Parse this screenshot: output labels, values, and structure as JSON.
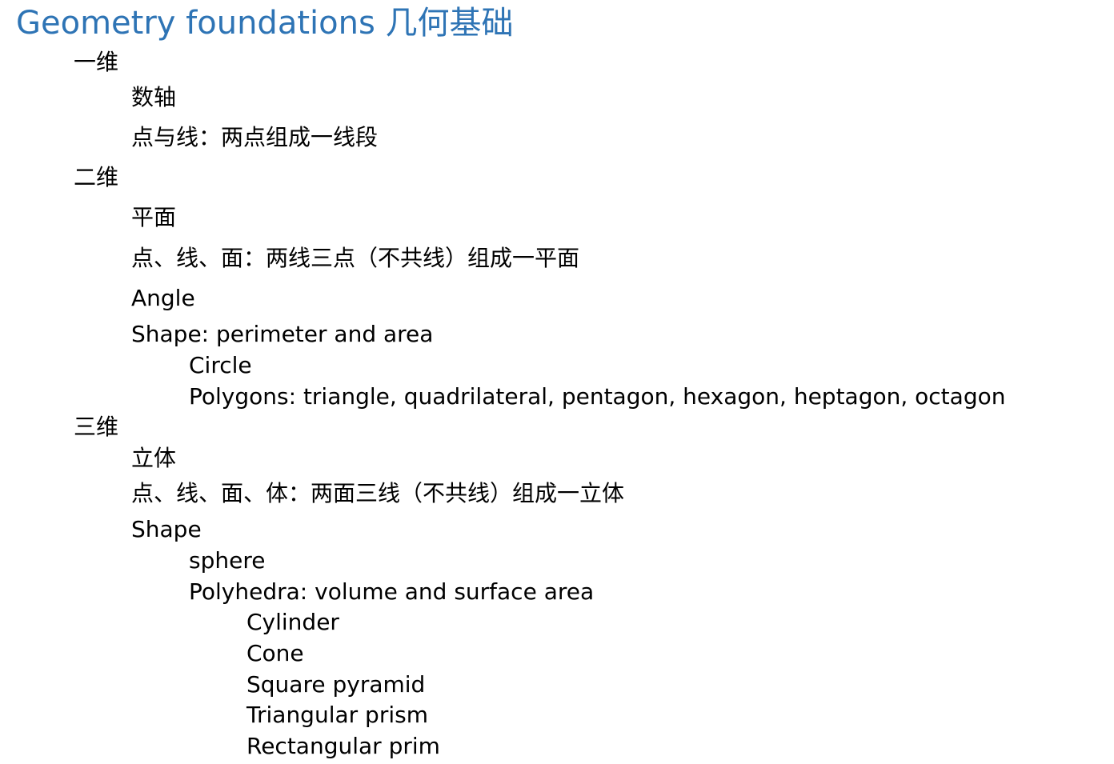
{
  "title": "Geometry foundations 几何基础",
  "sections": {
    "one_d": {
      "label": "一维",
      "items": [
        "数轴",
        "点与线：两点组成一线段"
      ]
    },
    "two_d": {
      "label": "二维",
      "items": [
        "平面",
        "点、线、面：两线三点（不共线）组成一平面",
        "Angle",
        "Shape: perimeter and area"
      ],
      "shape_items": [
        "Circle",
        "Polygons: triangle, quadrilateral, pentagon, hexagon, heptagon, octagon"
      ]
    },
    "three_d": {
      "label": "三维",
      "items": [
        "立体",
        "点、线、面、体：两面三线（不共线）组成一立体",
        "Shape"
      ],
      "shape_items": [
        "sphere",
        "Polyhedra: volume and surface area"
      ],
      "polyhedra_items": [
        "Cylinder",
        "Cone",
        "Square pyramid",
        "Triangular prism",
        "Rectangular prim"
      ]
    }
  }
}
